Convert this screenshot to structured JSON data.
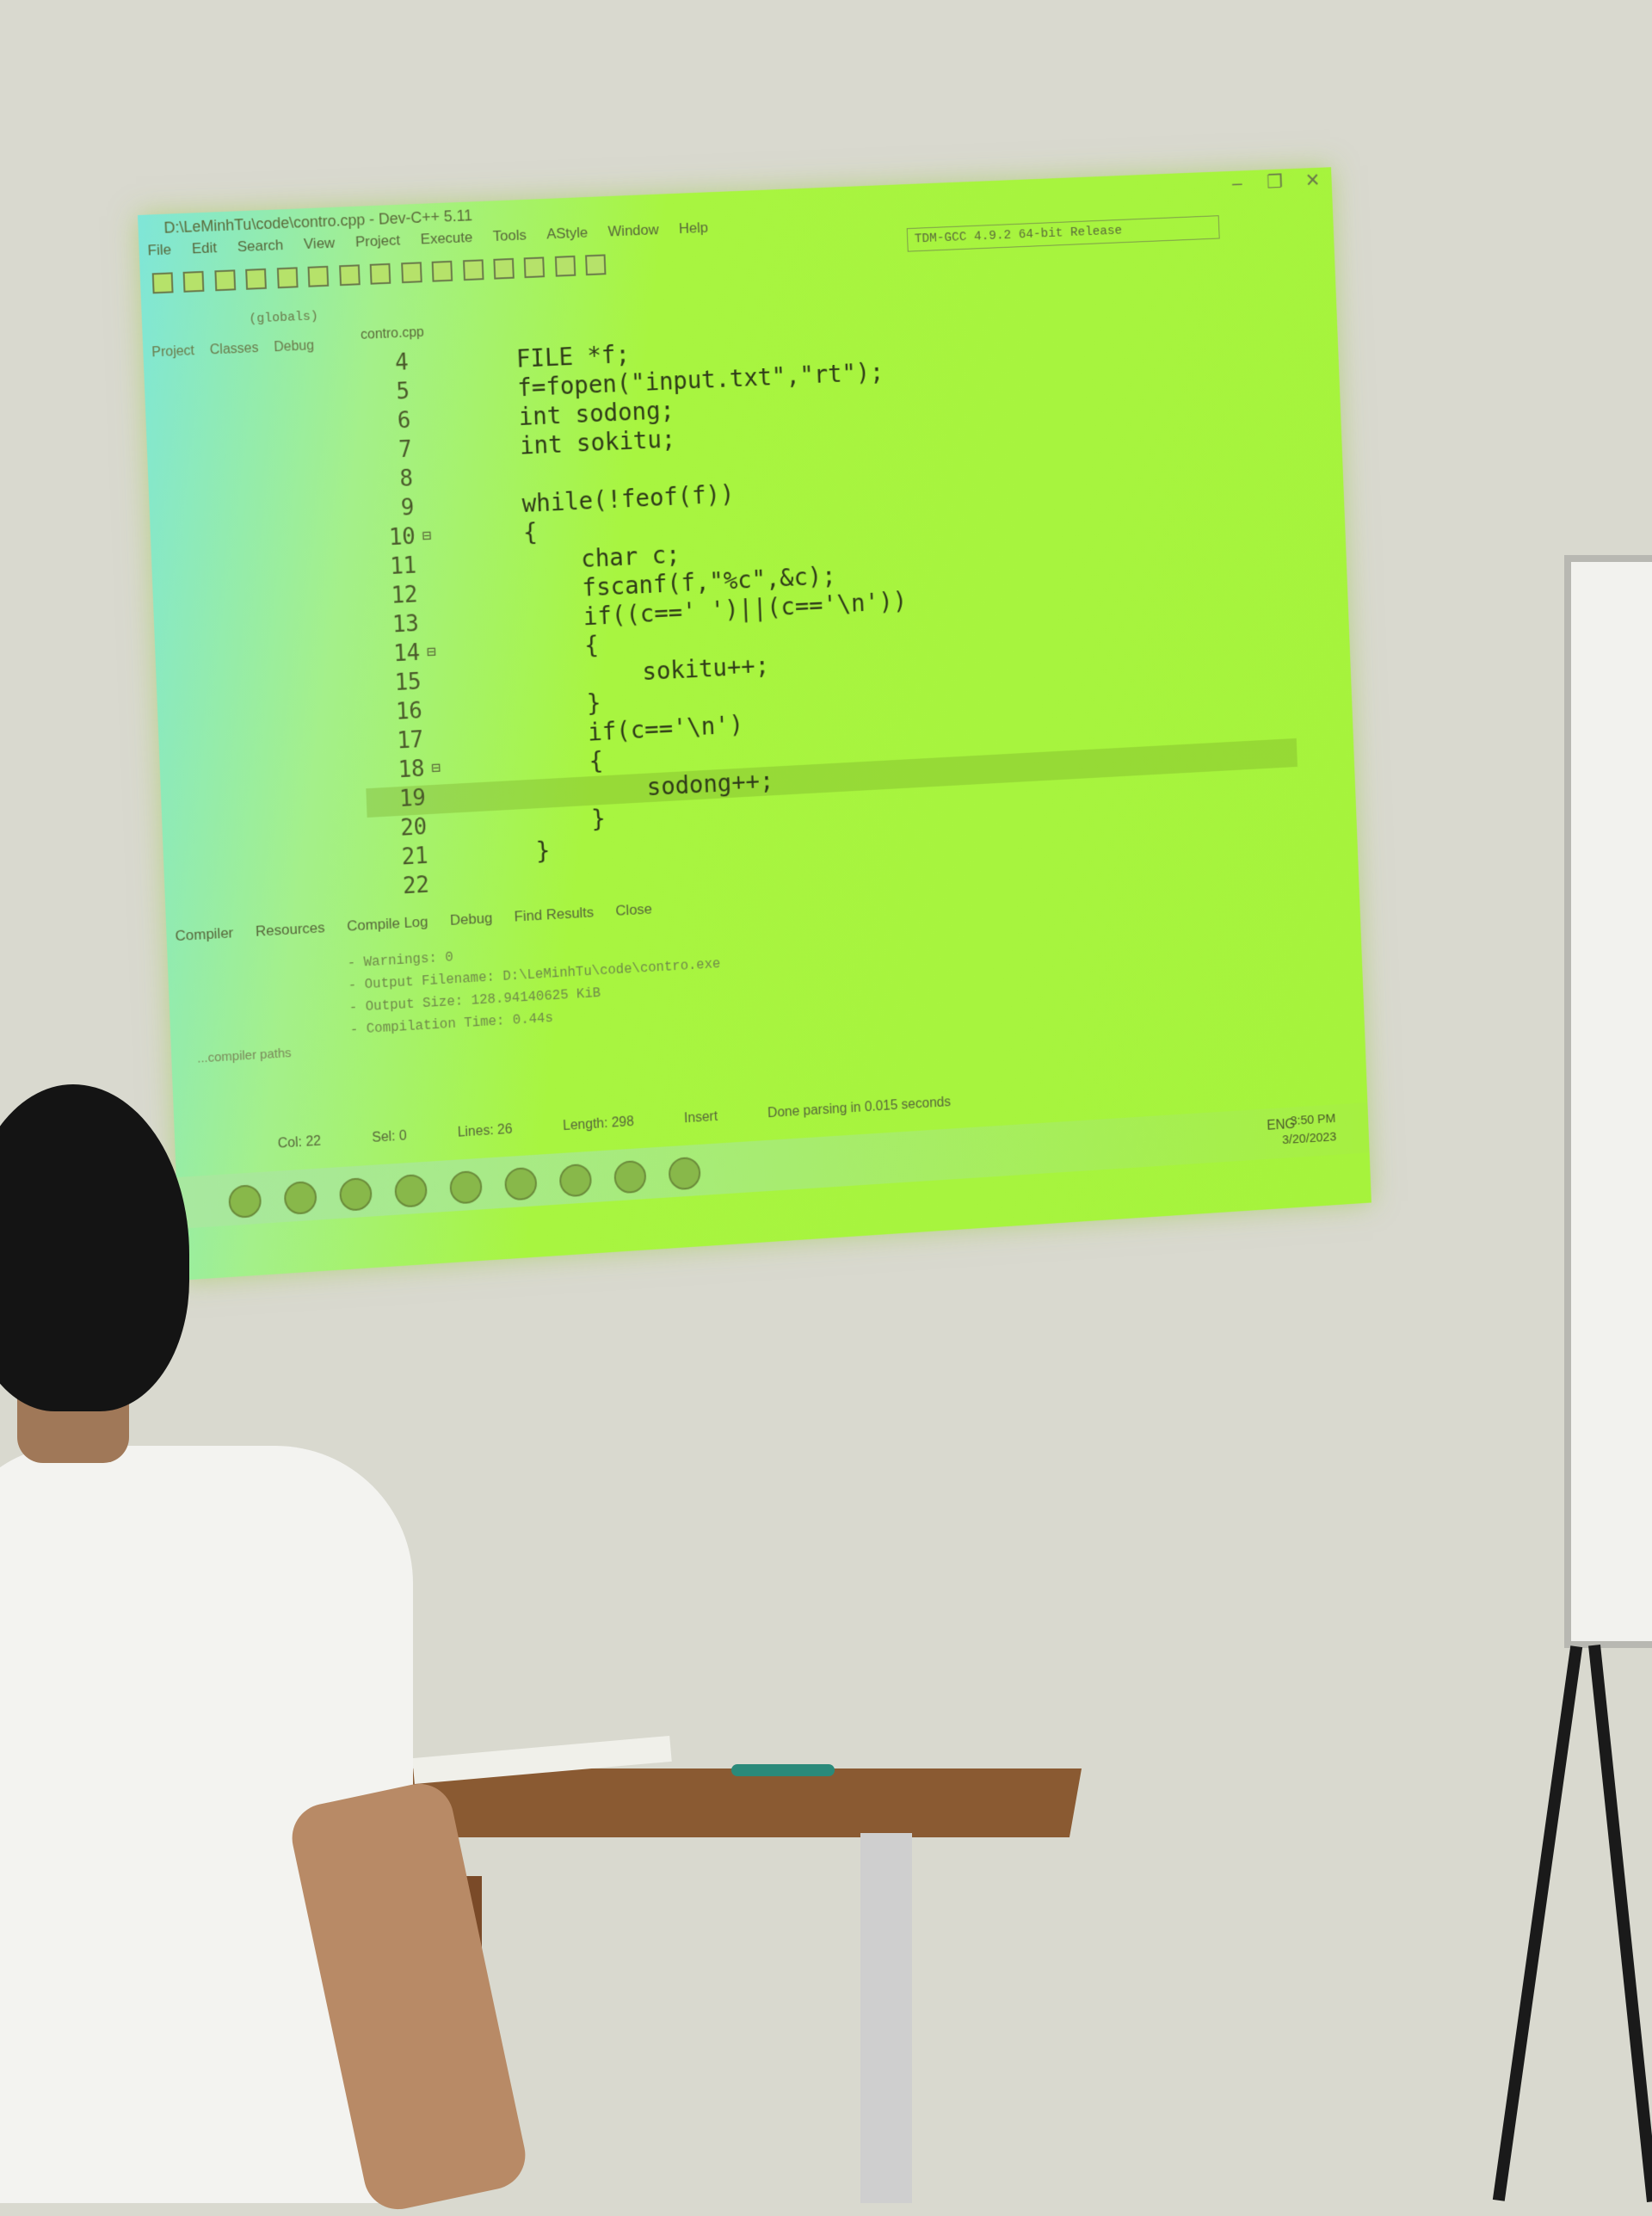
{
  "window": {
    "title": "D:\\LeMinhTu\\code\\contro.cpp - Dev-C++ 5.11",
    "compiler": "TDM-GCC 4.9.2 64-bit Release"
  },
  "menu": [
    "File",
    "Edit",
    "Search",
    "View",
    "Project",
    "Execute",
    "Tools",
    "AStyle",
    "Window",
    "Help"
  ],
  "globals": "(globals)",
  "panel_tabs": [
    "Project",
    "Classes",
    "Debug"
  ],
  "file_tab": "contro.cpp",
  "code_lines": [
    {
      "num": "4",
      "fold": "",
      "text": "    FILE *f;"
    },
    {
      "num": "5",
      "fold": "",
      "text": "    f=fopen(\"input.txt\",\"rt\");"
    },
    {
      "num": "6",
      "fold": "",
      "text": "    int sodong;"
    },
    {
      "num": "7",
      "fold": "",
      "text": "    int sokitu;"
    },
    {
      "num": "8",
      "fold": "",
      "text": ""
    },
    {
      "num": "9",
      "fold": "",
      "text": "    while(!feof(f))"
    },
    {
      "num": "10",
      "fold": "⊟",
      "text": "    {"
    },
    {
      "num": "11",
      "fold": "",
      "text": "        char c;"
    },
    {
      "num": "12",
      "fold": "",
      "text": "        fscanf(f,\"%c\",&c);"
    },
    {
      "num": "13",
      "fold": "",
      "text": "        if((c==' ')||(c=='\\n'))"
    },
    {
      "num": "14",
      "fold": "⊟",
      "text": "        {"
    },
    {
      "num": "15",
      "fold": "",
      "text": "            sokitu++;"
    },
    {
      "num": "16",
      "fold": "",
      "text": "        }"
    },
    {
      "num": "17",
      "fold": "",
      "text": "        if(c=='\\n')"
    },
    {
      "num": "18",
      "fold": "⊟",
      "text": "        {"
    },
    {
      "num": "19",
      "fold": "",
      "text": "            sodong++;"
    },
    {
      "num": "20",
      "fold": "",
      "text": "        }"
    },
    {
      "num": "21",
      "fold": "",
      "text": "    }"
    },
    {
      "num": "22",
      "fold": "",
      "text": ""
    }
  ],
  "message_tabs": [
    "Compiler",
    "Resources",
    "Compile Log",
    "Debug",
    "Find Results",
    "Close"
  ],
  "compile_log": [
    "- Warnings: 0",
    "- Output Filename: D:\\LeMinhTu\\code\\contro.exe",
    "- Output Size: 128.94140625 KiB",
    "- Compilation Time: 0.44s"
  ],
  "side_note": "...compiler paths",
  "status": {
    "col": "Col: 22",
    "sel": "Sel: 0",
    "lines": "Lines: 26",
    "length": "Length: 298",
    "mode": "Insert",
    "message": "Done parsing in 0.015 seconds"
  },
  "taskbar": {
    "lang": "ENG",
    "time": "3:50 PM",
    "date": "3/20/2023"
  }
}
